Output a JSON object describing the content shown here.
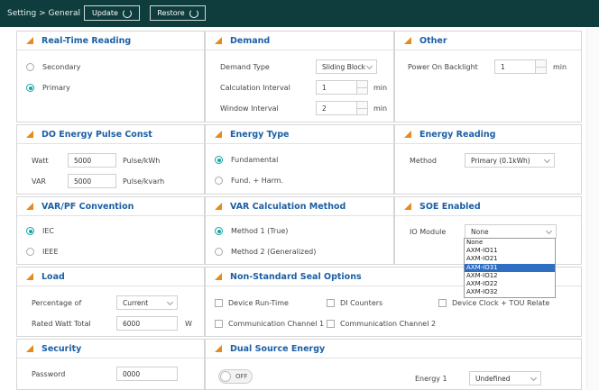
{
  "topbar": {
    "breadcrumb": "Setting > General",
    "update_label": "Update",
    "restore_label": "Restore"
  },
  "realtime": {
    "title": "Real-Time Reading",
    "options": [
      "Secondary",
      "Primary"
    ],
    "selected": "Primary"
  },
  "demand": {
    "title": "Demand",
    "type_label": "Demand Type",
    "type_value": "Sliding Block",
    "calc_label": "Calculation Interval",
    "calc_value": "1",
    "calc_unit": "min",
    "window_label": "Window Interval",
    "window_value": "2",
    "window_unit": "min"
  },
  "other": {
    "title": "Other",
    "backlight_label": "Power On Backlight",
    "backlight_value": "1",
    "backlight_unit": "min"
  },
  "pulse": {
    "title": "DO Energy Pulse Const",
    "watt_label": "Watt",
    "watt_value": "5000",
    "watt_unit": "Pulse/kWh",
    "var_label": "VAR",
    "var_value": "5000",
    "var_unit": "Pulse/kvarh"
  },
  "energy_type": {
    "title": "Energy Type",
    "options": [
      "Fundamental",
      "Fund. + Harm."
    ],
    "selected": "Fundamental"
  },
  "energy_reading": {
    "title": "Energy Reading",
    "method_label": "Method",
    "method_value": "Primary (0.1kWh)"
  },
  "varpf": {
    "title": "VAR/PF Convention",
    "options": [
      "IEC",
      "IEEE"
    ],
    "selected": "IEC"
  },
  "varcalc": {
    "title": "VAR Calculation Method",
    "options": [
      "Method 1 (True)",
      "Method 2 (Generalized)"
    ],
    "selected": "Method 1 (True)"
  },
  "soe": {
    "title": "SOE Enabled",
    "io_label": "IO Module",
    "io_value": "None",
    "options": [
      "None",
      "AXM-IO11",
      "AXM-IO21",
      "AXM-IO31",
      "AXM-IO12",
      "AXM-IO22",
      "AXM-IO32"
    ],
    "highlighted": "AXM-IO31"
  },
  "load": {
    "title": "Load",
    "pct_label": "Percentage of",
    "pct_value": "Current",
    "rated_label": "Rated Watt Total",
    "rated_value": "6000",
    "rated_unit": "W"
  },
  "seal": {
    "title": "Non-Standard Seal Options",
    "options": [
      "Device Run-Time",
      "DI Counters",
      "Device Clock + TOU Relate",
      "Communication Channel 1",
      "Communication Channel 2"
    ]
  },
  "security": {
    "title": "Security",
    "password_label": "Password",
    "password_value": "0000"
  },
  "dual": {
    "title": "Dual Source Energy",
    "toggle_label": "OFF",
    "energy1_label": "Energy 1",
    "energy1_value": "Undefined"
  },
  "colors": {
    "topbar": "#0f3d3d",
    "title": "#1b5fa5",
    "accent": "#e8891b",
    "radio": "#16a3a3",
    "highlight": "#2e6fc2"
  }
}
